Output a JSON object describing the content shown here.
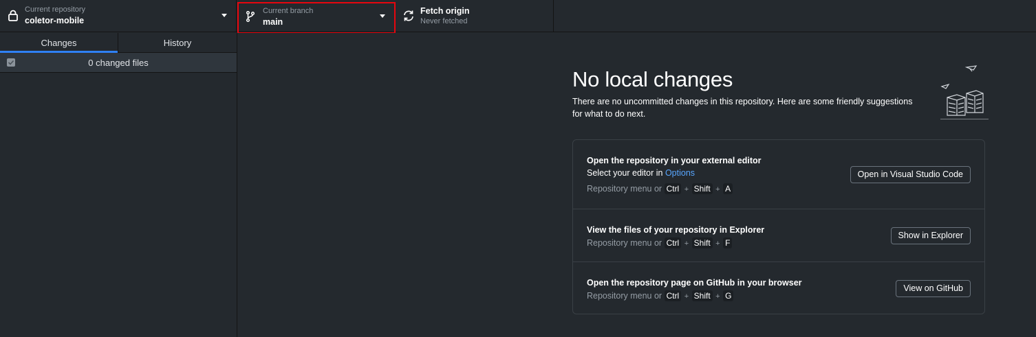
{
  "toolbar": {
    "repository": {
      "label": "Current repository",
      "value": "coletor-mobile"
    },
    "branch": {
      "label": "Current branch",
      "value": "main"
    },
    "fetch": {
      "label": "Fetch origin",
      "status": "Never fetched"
    }
  },
  "sidebar": {
    "tabs": [
      {
        "label": "Changes",
        "selected": true
      },
      {
        "label": "History",
        "selected": false
      }
    ],
    "files_summary": "0 changed files"
  },
  "main": {
    "title": "No local changes",
    "description": "There are no uncommitted changes in this repository. Here are some friendly suggestions for what to do next.",
    "actions": [
      {
        "title": "Open the repository in your external editor",
        "subtitle_prefix": "Select your editor in ",
        "subtitle_link": "Options",
        "hint_prefix": "Repository menu or ",
        "keys": [
          "Ctrl",
          "Shift",
          "A"
        ],
        "button": "Open in Visual Studio Code"
      },
      {
        "title": "View the files of your repository in Explorer",
        "hint_prefix": "Repository menu or ",
        "keys": [
          "Ctrl",
          "Shift",
          "F"
        ],
        "button": "Show in Explorer"
      },
      {
        "title": "Open the repository page on GitHub in your browser",
        "hint_prefix": "Repository menu or ",
        "keys": [
          "Ctrl",
          "Shift",
          "G"
        ],
        "button": "View on GitHub"
      }
    ],
    "key_separator": "+"
  },
  "icons": {
    "repository": "lock-icon",
    "branch": "git-branch-icon",
    "fetch": "sync-icon",
    "dropdown": "triangle-down-icon",
    "checkbox": "checkbox-checked-icon",
    "illustration": "empty-state-illustration"
  },
  "colors": {
    "background": "#24292e",
    "highlight_border": "#e8060e",
    "tab_selected": "#2f81f7",
    "link": "#58a6ff"
  }
}
